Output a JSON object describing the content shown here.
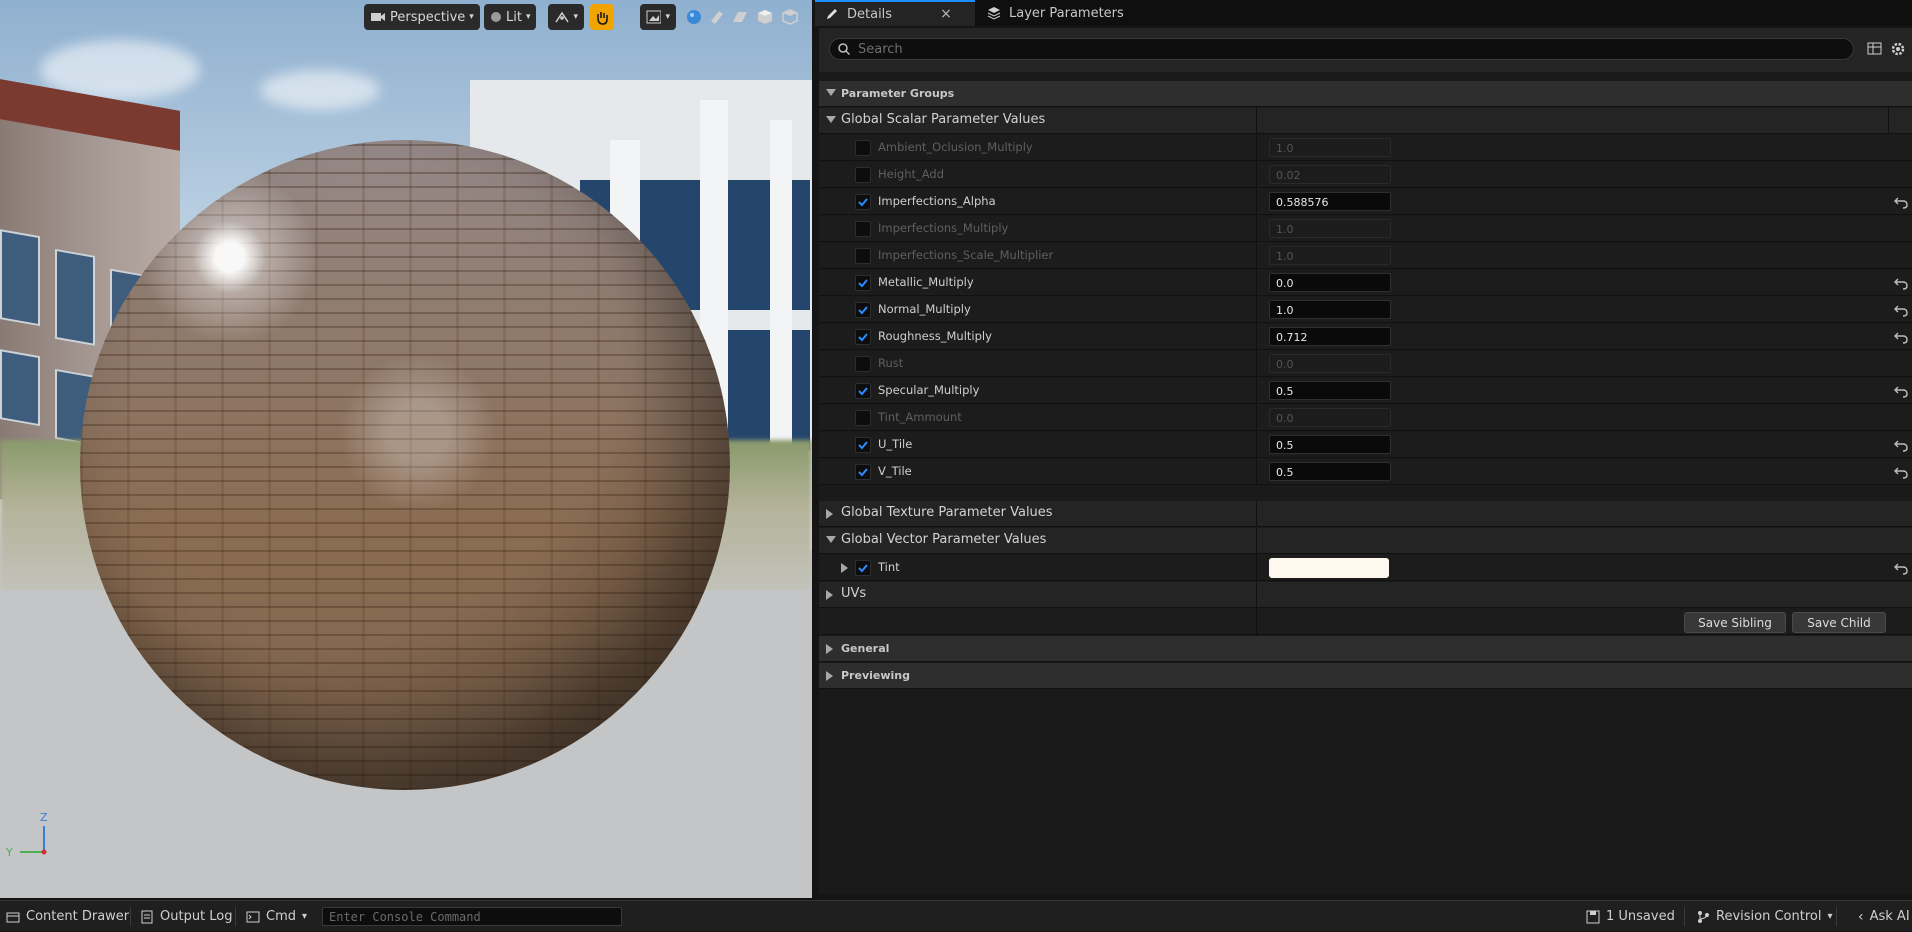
{
  "viewport": {
    "perspective_label": "Perspective",
    "lit_label": "Lit",
    "axis_z": "Z",
    "axis_y": "Y"
  },
  "tabs": {
    "details": "Details",
    "layer_parameters": "Layer Parameters",
    "close_glyph": "×"
  },
  "search": {
    "placeholder": "Search"
  },
  "sections": {
    "parameter_groups": "Parameter Groups",
    "global_scalar": "Global Scalar Parameter Values",
    "global_texture": "Global Texture Parameter Values",
    "global_vector": "Global Vector Parameter Values",
    "uvs": "UVs",
    "general": "General",
    "previewing": "Previewing"
  },
  "scalar_params": [
    {
      "name": "Ambient_Oclusion_Multiply",
      "value": "1.0",
      "enabled": false
    },
    {
      "name": "Height_Add",
      "value": "0.02",
      "enabled": false
    },
    {
      "name": "Imperfections_Alpha",
      "value": "0.588576",
      "enabled": true
    },
    {
      "name": "Imperfections_Multiply",
      "value": "1.0",
      "enabled": false
    },
    {
      "name": "Imperfections_Scale_Multiplier",
      "value": "1.0",
      "enabled": false
    },
    {
      "name": "Metallic_Multiply",
      "value": "0.0",
      "enabled": true
    },
    {
      "name": "Normal_Multiply",
      "value": "1.0",
      "enabled": true
    },
    {
      "name": "Roughness_Multiply",
      "value": "0.712",
      "enabled": true
    },
    {
      "name": "Rust",
      "value": "0.0",
      "enabled": false
    },
    {
      "name": "Specular_Multiply",
      "value": "0.5",
      "enabled": true
    },
    {
      "name": "Tint_Ammount",
      "value": "0.0",
      "enabled": false
    },
    {
      "name": "U_Tile",
      "value": "0.5",
      "enabled": true
    },
    {
      "name": "V_Tile",
      "value": "0.5",
      "enabled": true
    }
  ],
  "vector_params": [
    {
      "name": "Tint",
      "enabled": true,
      "color": "#fff8ee"
    }
  ],
  "buttons": {
    "save_sibling": "Save Sibling",
    "save_child": "Save Child"
  },
  "statusbar": {
    "content_drawer": "Content Drawer",
    "output_log": "Output Log",
    "cmd": "Cmd",
    "console_placeholder": "Enter Console Command",
    "unsaved": "1 Unsaved",
    "revision_control": "Revision Control",
    "ask_ai": "Ask AI"
  },
  "colors": {
    "accent_blue": "#1e8fff",
    "accent_orange": "#f1a300",
    "checkbox_check": "#2a8cff"
  }
}
